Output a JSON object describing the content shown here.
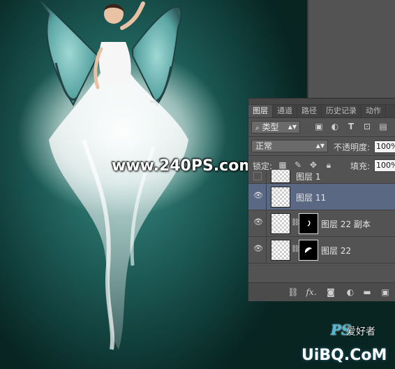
{
  "artwork": {
    "watermark": "www.240PS.com",
    "logo_text": "UiBQ.CoM",
    "logo_ps": "PS",
    "logo_cn": "爱好者"
  },
  "panel": {
    "tabs": [
      "图层",
      "通道",
      "路径",
      "历史记录",
      "动作"
    ],
    "filter": {
      "value": "类型"
    },
    "filter_icons": [
      "image-filter-icon",
      "adjustment-filter-icon",
      "type-filter-icon",
      "shape-filter-icon",
      "smart-object-filter-icon"
    ],
    "blend_mode": "正常",
    "opacity_label": "不透明度:",
    "opacity_value": "100%",
    "lock_label": "锁定:",
    "fill_label": "填充:",
    "fill_value": "100%",
    "layers": [
      {
        "name": "图层 1",
        "visible": false,
        "selected": false,
        "has_mask": false
      },
      {
        "name": "图层 11",
        "visible": true,
        "selected": true,
        "has_mask": false
      },
      {
        "name": "图层 22 副本",
        "visible": true,
        "selected": false,
        "has_mask": true
      },
      {
        "name": "图层 22",
        "visible": true,
        "selected": false,
        "has_mask": true
      }
    ],
    "footer_icons": [
      "link-layers-icon",
      "fx-icon",
      "add-mask-icon",
      "adjustment-layer-icon",
      "new-group-icon",
      "new-layer-icon"
    ]
  },
  "colors": {
    "background_teal": "#1f5f5a",
    "panel_bg": "#535353",
    "selected_layer": "#5a6884"
  }
}
